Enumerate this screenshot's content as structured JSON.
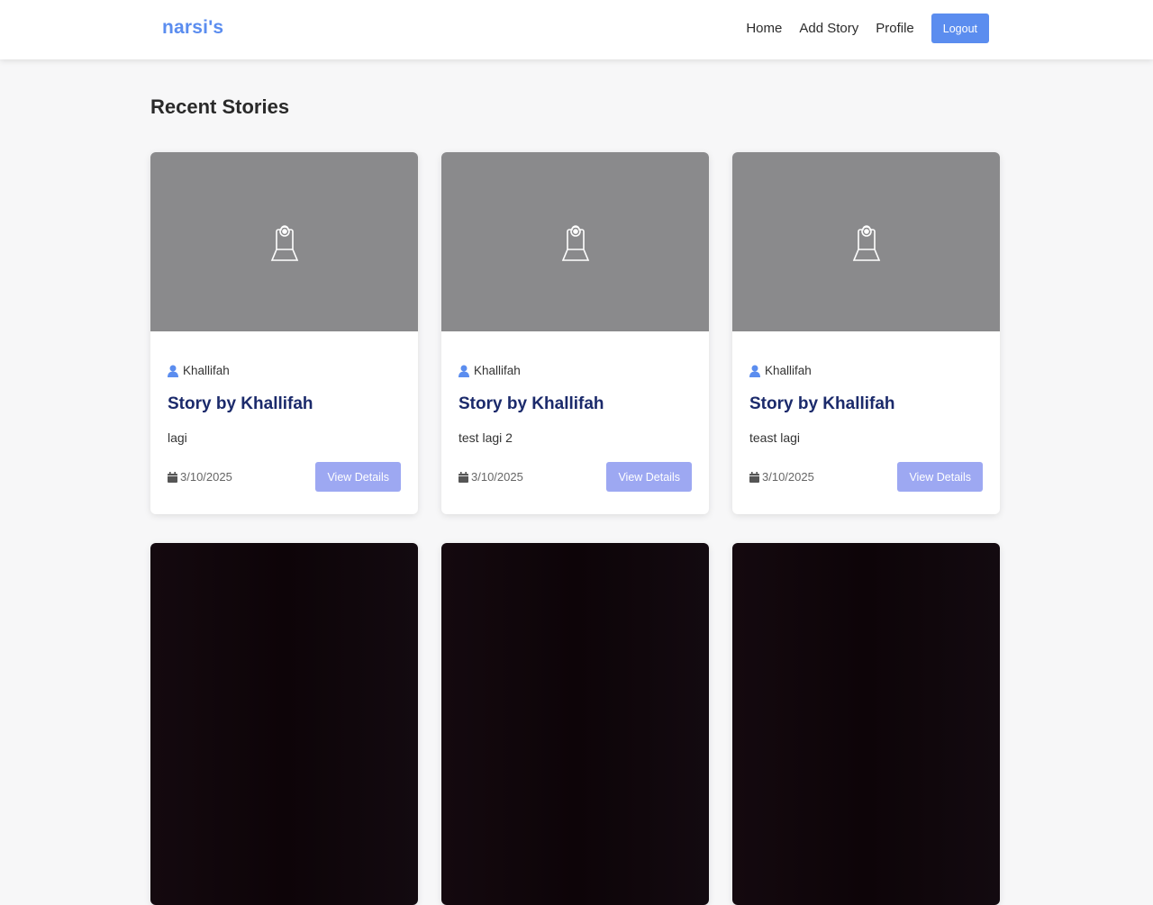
{
  "brand": "narsi's",
  "nav": {
    "home": "Home",
    "add_story": "Add Story",
    "profile": "Profile",
    "logout": "Logout"
  },
  "colors": {
    "accent": "#5b8def",
    "button_light": "#9da8f2",
    "title_navy": "#1b2a6b",
    "image_placeholder": "#8a8a8c"
  },
  "page_title": "Recent Stories",
  "stories": [
    {
      "author": "Khallifah",
      "title": "Story by Khallifah",
      "description": "lagi",
      "date": "3/10/2025",
      "button": "View Details",
      "image_icon": "camera-placeholder-icon"
    },
    {
      "author": "Khallifah",
      "title": "Story by Khallifah",
      "description": "test lagi 2",
      "date": "3/10/2025",
      "button": "View Details",
      "image_icon": "camera-placeholder-icon"
    },
    {
      "author": "Khallifah",
      "title": "Story by Khallifah",
      "description": "teast lagi",
      "date": "3/10/2025",
      "button": "View Details",
      "image_icon": "camera-placeholder-icon"
    }
  ],
  "icons": {
    "author": "user-icon",
    "date": "calendar-icon"
  }
}
